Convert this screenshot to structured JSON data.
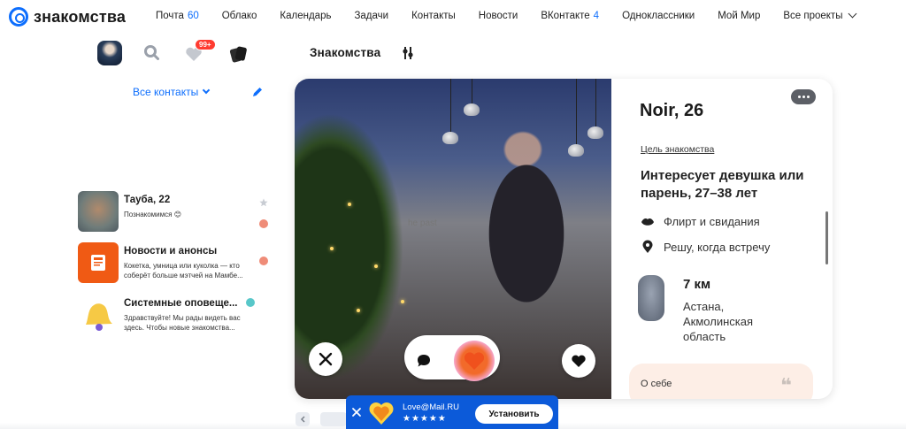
{
  "app": {
    "logo_text": "знакомства"
  },
  "nav": {
    "items": [
      {
        "label": "Почта",
        "count": "60"
      },
      {
        "label": "Облако",
        "count": ""
      },
      {
        "label": "Календарь",
        "count": ""
      },
      {
        "label": "Задачи",
        "count": ""
      },
      {
        "label": "Контакты",
        "count": ""
      },
      {
        "label": "Новости",
        "count": ""
      },
      {
        "label": "ВКонтакте",
        "count": "4"
      },
      {
        "label": "Одноклассники",
        "count": ""
      },
      {
        "label": "Мой Мир",
        "count": ""
      },
      {
        "label": "Все проекты",
        "count": ""
      }
    ]
  },
  "toolbar": {
    "likes_badge": "99+"
  },
  "section": {
    "title": "Знакомства"
  },
  "sidebar": {
    "filter_label": "Все контакты",
    "contacts": [
      {
        "name": "Тауба, 22",
        "message": "Познакомимся 😊"
      },
      {
        "name": "Новости и анонсы",
        "message": "Кокетка, умница или куколка — кто соберёт больше мэтчей на Мамбе..."
      },
      {
        "name": "Системные оповеще...",
        "message": "Здравствуйте! Мы рады видеть вас здесь. Чтобы новые знакомства..."
      }
    ]
  },
  "profile": {
    "name_age": "Noir, 26",
    "goal_label": "Цель знакомства",
    "goal_text": "Интересует девушка или парень, 27–38 лет",
    "tags": [
      "Флирт и свидания",
      "Решу, когда встречу"
    ],
    "distance": "7 км",
    "location": "Астана, Акмолинская область",
    "about_label": "О себе",
    "photo_sign": "he past"
  },
  "promo": {
    "app_name": "Love@Mail.RU",
    "rating_stars": "★★★★★",
    "install_label": "Установить"
  },
  "colors": {
    "accent": "#0d6efd",
    "promo_bg": "#0c5ad9",
    "badge": "#ff3b30",
    "about_bg": "#fdeee6"
  }
}
